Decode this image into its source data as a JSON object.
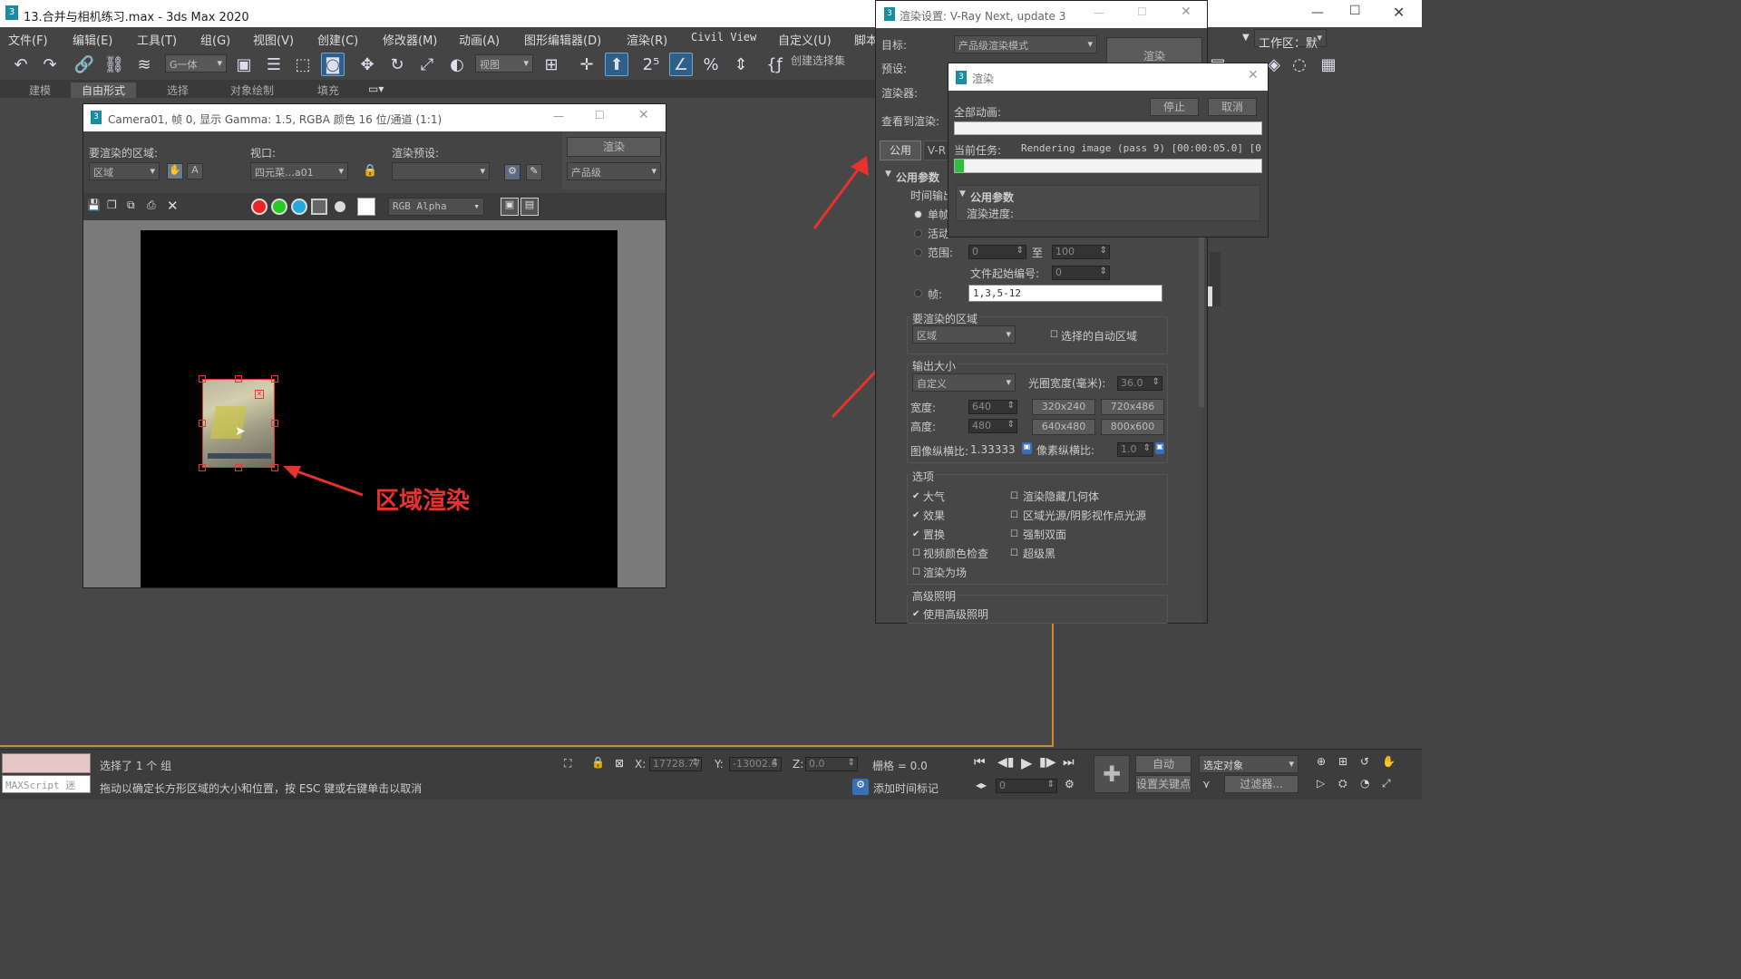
{
  "app": {
    "title": "13.合并与相机练习.max - 3ds Max 2020"
  },
  "menu": [
    "文件(F)",
    "编辑(E)",
    "工具(T)",
    "组(G)",
    "视图(V)",
    "创建(C)",
    "修改器(M)",
    "动画(A)",
    "图形编辑器(D)",
    "渲染(R)",
    "Civil View",
    "自定义(U)",
    "脚本"
  ],
  "toolbar": {
    "selection_filter": "G一体",
    "view_dropdown": "视图",
    "named_sel": "创建选择集",
    "workspace": "工作区：默认"
  },
  "ribbon": [
    "建模",
    "自由形式",
    "选择",
    "对象绘制",
    "填充"
  ],
  "frame_window": {
    "title": "Camera01, 帧 0, 显示 Gamma: 1.5, RGBA 颜色 16 位/通道 (1:1)",
    "area_label": "要渲染的区域:",
    "area_value": "区域",
    "viewport_label": "视口:",
    "viewport_value": "四元菜…a01",
    "preset_label": "渲染预设:",
    "preset_value": "",
    "render_button": "渲染",
    "quality_value": "产品级",
    "channel": "RGB Alpha"
  },
  "annotation": {
    "text": "区域渲染"
  },
  "render_setup": {
    "title": "渲染设置: V-Ray Next, update 3",
    "target_label": "目标:",
    "target_value": "产品级渲染模式",
    "preset_label": "预设:",
    "renderer_label": "渲染器:",
    "view_label": "查看到渲染:",
    "render_button": "渲染",
    "tab_common": "公用",
    "tab_vray": "V-R",
    "section_common": "公用参数",
    "time_output": "时间输出",
    "opt_single": "单帧",
    "opt_active": "活动",
    "opt_range": "范围:",
    "range_from": "0",
    "range_to_label": "至",
    "range_to": "100",
    "file_start_label": "文件起始编号:",
    "file_start": "0",
    "frames_label": "帧:",
    "frames_value": "1,3,5-12",
    "area_group": "要渲染的区域",
    "area_value": "区域",
    "auto_region": "选择的自动区域",
    "output_size": "输出大小",
    "size_preset": "自定义",
    "aperture_label": "光圈宽度(毫米):",
    "aperture_value": "36.0",
    "width_label": "宽度:",
    "width_value": "640",
    "height_label": "高度:",
    "height_value": "480",
    "preset_sizes": [
      "320x240",
      "720x486",
      "640x480",
      "800x600"
    ],
    "image_aspect_label": "图像纵横比:",
    "image_aspect_value": "1.33333",
    "pixel_aspect_label": "像素纵横比:",
    "pixel_aspect_value": "1.0",
    "options_group": "选项",
    "options_left": [
      {
        "label": "大气",
        "checked": true
      },
      {
        "label": "效果",
        "checked": true
      },
      {
        "label": "置换",
        "checked": true
      },
      {
        "label": "视频颜色检查",
        "checked": false
      },
      {
        "label": "渲染为场",
        "checked": false
      }
    ],
    "options_right": [
      {
        "label": "渲染隐藏几何体",
        "checked": false
      },
      {
        "label": "区域光源/阴影视作点光源",
        "checked": false
      },
      {
        "label": "强制双面",
        "checked": false
      },
      {
        "label": "超级黑",
        "checked": false
      }
    ],
    "adv_lighting": "高级照明",
    "use_adv_lighting": "使用高级照明"
  },
  "render_dialog": {
    "title": "渲染",
    "all_anim": "全部动画:",
    "stop": "停止",
    "cancel": "取消",
    "current_task_label": "当前任务:",
    "current_task": "Rendering image (pass 9) [00:00:05.0] [0",
    "progress_fraction": 0.03,
    "section": "公用参数",
    "render_progress": "渲染进度:"
  },
  "status": {
    "selected": "选择了 1 个 组",
    "hint": "拖动以确定长方形区域的大小和位置，按 ESC 键或右键单击以取消",
    "maxscript": "MAXScript 迷",
    "x_label": "X:",
    "x_value": "17728.77",
    "y_label": "Y:",
    "y_value": "-13002.6",
    "z_label": "Z:",
    "z_value": "0.0",
    "grid_label": "栅格 = 0.0",
    "add_time_tag": "添加时间标记",
    "auto": "自动",
    "set_key": "设置关键点",
    "selected_obj": "选定对象",
    "filter": "过滤器...",
    "frame": "0"
  },
  "colors": {
    "accent": "#2f5f86",
    "viewport_border": "#ca8d28",
    "annotation": "#e8322d",
    "progress": "#2fbf3a"
  }
}
